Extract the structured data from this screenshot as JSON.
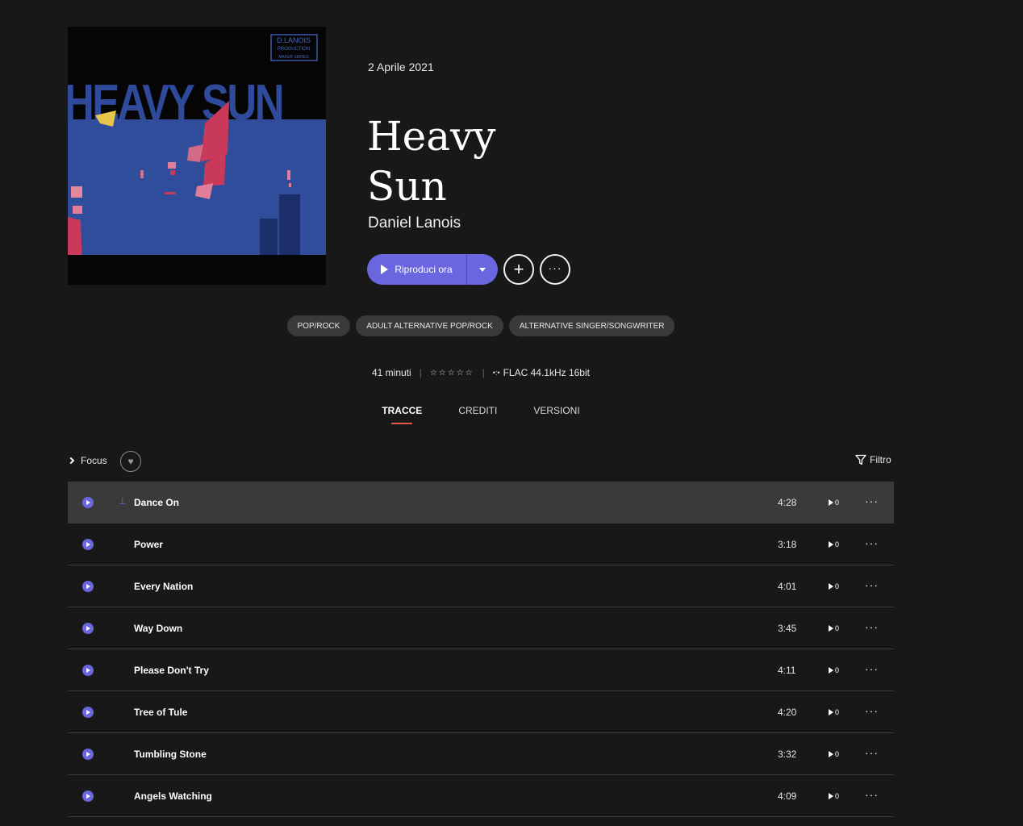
{
  "album": {
    "release_date": "2 Aprile 2021",
    "title": "Heavy Sun",
    "artist": "Daniel Lanois",
    "cover": {
      "title_text": "HEAVY SUN",
      "label_text": "D. LANOIS PRODUCTION",
      "series_text": "MAKER SERIES"
    }
  },
  "actions": {
    "play_label": "Riproduci ora"
  },
  "genres": [
    "POP/ROCK",
    "ADULT ALTERNATIVE POP/ROCK",
    "ALTERNATIVE SINGER/SONGWRITER"
  ],
  "meta": {
    "duration": "41 minuti",
    "rating_stars": "☆☆☆☆☆",
    "quality": "FLAC 44.1kHz 16bit"
  },
  "tabs": [
    {
      "label": "TRACCE",
      "active": true
    },
    {
      "label": "CREDITI",
      "active": false
    },
    {
      "label": "VERSIONI",
      "active": false
    }
  ],
  "toolbar": {
    "focus_label": "Focus",
    "filter_label": "Filtro"
  },
  "tracks": [
    {
      "title": "Dance On",
      "duration": "4:28",
      "plays": "0"
    },
    {
      "title": "Power",
      "duration": "3:18",
      "plays": "0"
    },
    {
      "title": "Every Nation",
      "duration": "4:01",
      "plays": "0"
    },
    {
      "title": "Way Down",
      "duration": "3:45",
      "plays": "0"
    },
    {
      "title": "Please Don't Try",
      "duration": "4:11",
      "plays": "0"
    },
    {
      "title": "Tree of Tule",
      "duration": "4:20",
      "plays": "0"
    },
    {
      "title": "Tumbling Stone",
      "duration": "3:32",
      "plays": "0"
    },
    {
      "title": "Angels Watching",
      "duration": "4:09",
      "plays": "0"
    }
  ],
  "colors": {
    "background": "#181818",
    "accent": "#6966e0",
    "tab_underline": "#e2574c",
    "row_hover": "#3a3a3a",
    "pill": "#3a3a3a"
  }
}
